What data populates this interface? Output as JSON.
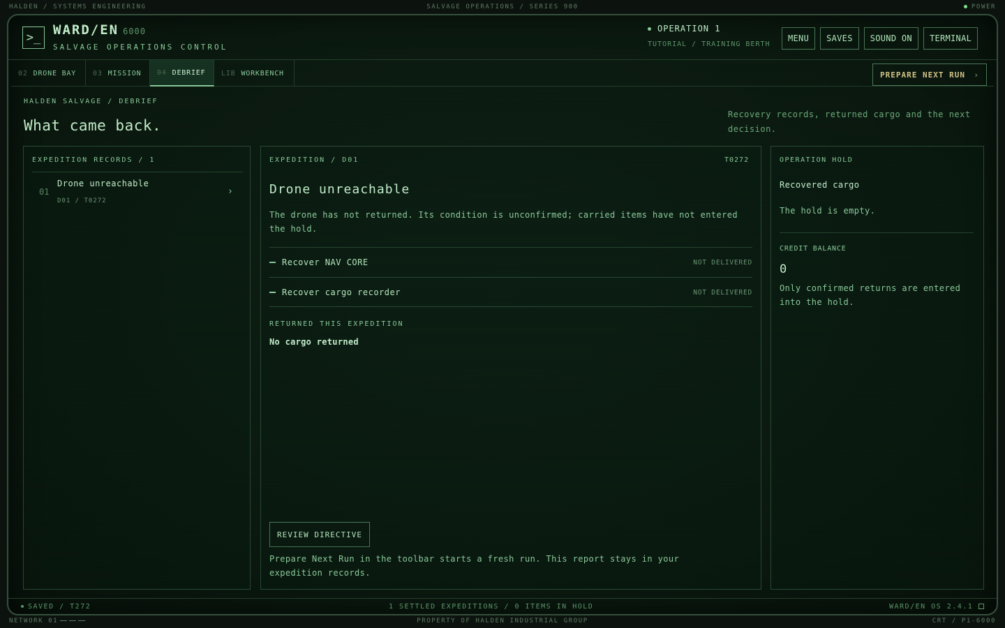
{
  "bezel": {
    "top_left": "HALDEN / SYSTEMS ENGINEERING",
    "top_center": "SALVAGE OPERATIONS / SERIES 900",
    "top_right": "POWER",
    "bottom_left": "NETWORK 01",
    "bottom_center": "PROPERTY OF HALDEN INDUSTRIAL GROUP",
    "bottom_right": "CRT / P1-6000"
  },
  "header": {
    "logo_glyph": ">_",
    "brand": "WARD/EN",
    "brand_num": "6000",
    "subtitle": "SALVAGE OPERATIONS CONTROL",
    "operation": "OPERATION 1",
    "operation_sub": "TUTORIAL / TRAINING BERTH",
    "buttons": [
      "MENU",
      "SAVES",
      "SOUND ON",
      "TERMINAL"
    ]
  },
  "tabs": [
    {
      "num": "02",
      "label": "DRONE BAY"
    },
    {
      "num": "03",
      "label": "MISSION"
    },
    {
      "num": "04",
      "label": "DEBRIEF"
    },
    {
      "num": "LIB",
      "label": "WORKBENCH"
    }
  ],
  "prepare_next": "PREPARE NEXT RUN",
  "page": {
    "breadcrumb": "HALDEN SALVAGE / DEBRIEF",
    "title": "What came back.",
    "description": "Recovery records, returned cargo and the next decision."
  },
  "records": {
    "heading": "EXPEDITION RECORDS / 1",
    "items": [
      {
        "num": "01",
        "title": "Drone unreachable",
        "sub": "D01 / T0272"
      }
    ]
  },
  "expedition": {
    "heading": "EXPEDITION / D01",
    "code": "T0272",
    "title": "Drone unreachable",
    "body": "The drone has not returned. Its condition is unconfirmed; carried items have not entered the hold.",
    "objectives": [
      {
        "label": "Recover NAV CORE",
        "status": "NOT DELIVERED"
      },
      {
        "label": "Recover cargo recorder",
        "status": "NOT DELIVERED"
      }
    ],
    "returned_heading": "RETURNED THIS EXPEDITION",
    "returned_value": "No cargo returned",
    "review_button": "REVIEW DIRECTIVE",
    "footer": "Prepare Next Run in the toolbar starts a fresh run. This report stays in your expedition records."
  },
  "hold": {
    "heading": "OPERATION HOLD",
    "title": "Recovered cargo",
    "empty": "The hold is empty.",
    "credit_heading": "CREDIT BALANCE",
    "credit_value": "0",
    "credit_note": "Only confirmed returns are entered into the hold."
  },
  "status": {
    "left": "SAVED / T272",
    "center": "1 SETTLED EXPEDITIONS / 0 ITEMS IN HOLD",
    "right": "WARD/EN OS 2.4.1"
  }
}
